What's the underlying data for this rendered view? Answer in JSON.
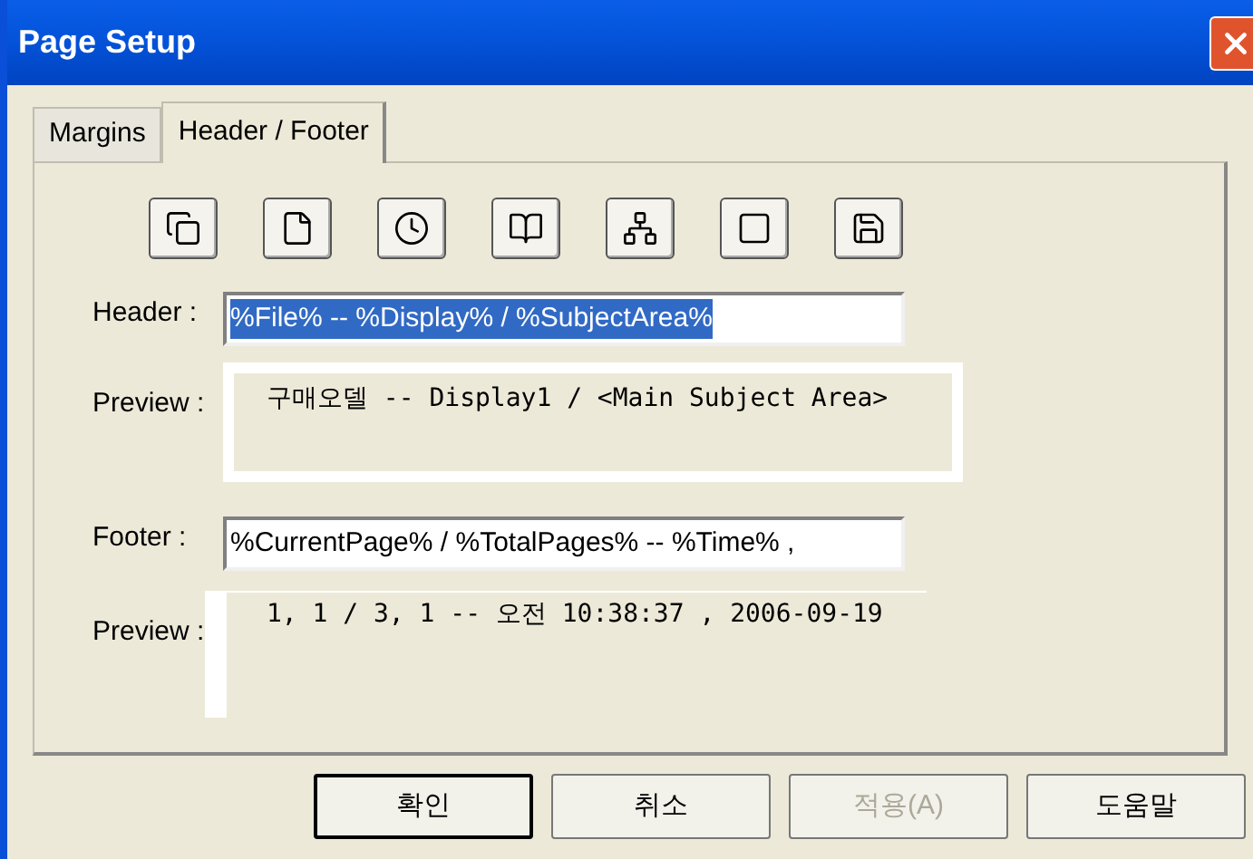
{
  "window": {
    "title": "Page Setup"
  },
  "tabs": [
    {
      "label": "Margins",
      "selected": false
    },
    {
      "label": "Header / Footer",
      "selected": true
    }
  ],
  "toolbar": [
    {
      "kind": "pages"
    },
    {
      "kind": "page"
    },
    {
      "kind": "clock"
    },
    {
      "kind": "book"
    },
    {
      "kind": "tree"
    },
    {
      "kind": "screen"
    },
    {
      "kind": "save"
    }
  ],
  "header": {
    "label": "Header :",
    "value": "%File% -- %Display% / %SubjectArea%",
    "text_selected": true
  },
  "header_preview": {
    "label": "Preview :",
    "text": "구매오델 -- Display1 / <Main Subject Area>"
  },
  "footer": {
    "label": "Footer :",
    "value": "%CurrentPage% / %TotalPages% -- %Time% ,",
    "text_selected": false
  },
  "footer_preview": {
    "label": "Preview :",
    "text": "1, 1  / 3, 1  -- 오전 10:38:37 , 2006-09-19"
  },
  "buttons": [
    {
      "label": "확인",
      "disabled": false,
      "default": true
    },
    {
      "label": "취소",
      "disabled": false,
      "default": false
    },
    {
      "label": "적용(A)",
      "disabled": true,
      "default": false
    },
    {
      "label": "도움말",
      "disabled": false,
      "default": false
    }
  ]
}
